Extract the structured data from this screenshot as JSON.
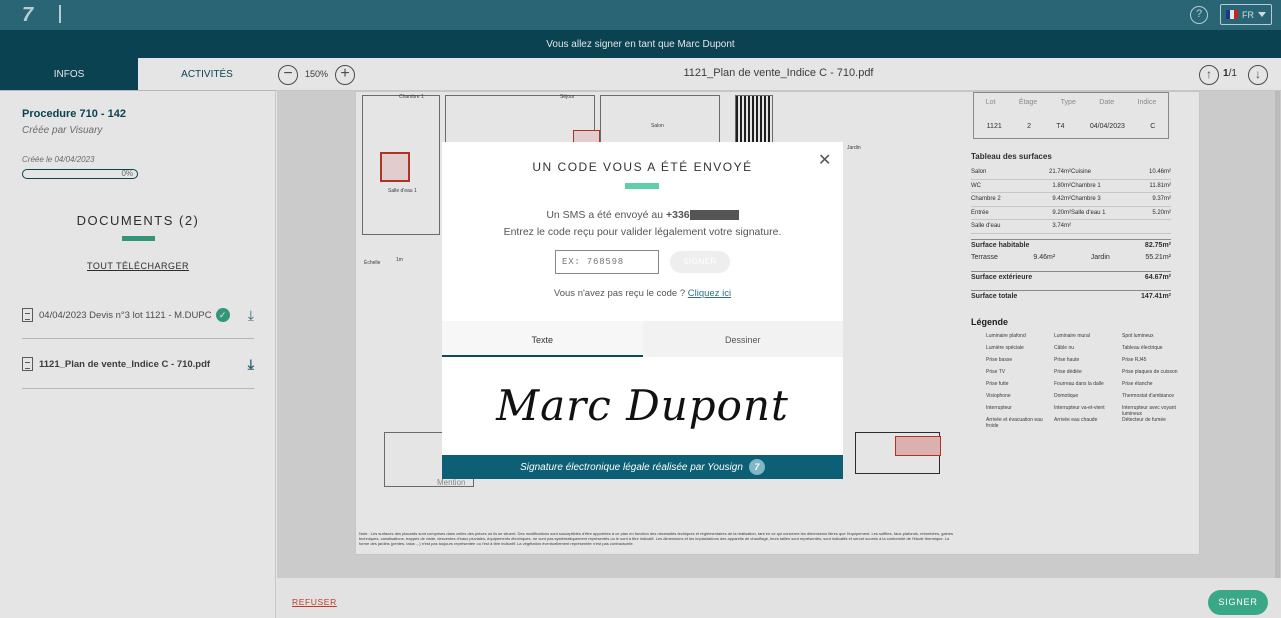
{
  "topbar": {
    "logo": "7",
    "help": "?",
    "lang": "FR",
    "flag_colors": [
      "#1f3f9a",
      "#ffffff",
      "#d42a2a"
    ]
  },
  "banner": {
    "text": "Vous allez signer en tant que Marc Dupont"
  },
  "tabs": [
    {
      "label": "INFOS"
    },
    {
      "label": "ACTIVITÉS"
    }
  ],
  "toolbar": {
    "zoom_out": "−",
    "zoom": "150%",
    "zoom_in": "+",
    "doc_name": "1121_Plan de vente_Indice C - 710.pdf",
    "page_current": "1",
    "page_sep": "/1"
  },
  "sidebar": {
    "procedure": "Procedure 710 - 142",
    "creator": "Créée par Visuary",
    "created": "Créée le 04/04/2023",
    "progress": "0%",
    "docs_title": "DOCUMENTS (2)",
    "download_all": "TOUT TÉLÉCHARGER",
    "documents": [
      {
        "name": "04/04/2023 Devis n°3 lot 1121 - M.DUPC",
        "signed": true
      },
      {
        "name": "1121_Plan de vente_Indice C - 710.pdf",
        "signed": false
      }
    ]
  },
  "plan": {
    "labels": [
      "Chambre 1",
      "Salle d'eau 1",
      "Séjour",
      "Jardin",
      "Échelle",
      "1m",
      "Mention",
      "Salon"
    ],
    "note": "Note : Les surfaces des placards sont comprises dans celles des pièces où ils se situent. Des modifications sont susceptibles d'être apportées à ce plan en fonction des nécessités techiques et réglementaires de la réalisation, tant en ce qui concerne les dimensions libres que l'équipement. Les soffites, faux-plafonds, retombées, gaines techniques, canalisations, trappes de visite, descentes d'eaux pluviales, équipements électriques, ne sont pas systématiquement représentés ou le sont à titre indicatif. Les dimensions et les implantations des appareils de chauffage, leurs tailles sont représentés, sont indicatifs et seront soumis à la conformité de l'étude thermique. La forme des jardins (pentes, talus ...) n'est pas toujours représentée ou l'est à titre indicatif. La végétation éventuellement représentée n'est pas contractuelle.",
    "lot_headers": [
      "Lot",
      "Étage",
      "Type",
      "Date",
      "Indice"
    ],
    "lot_values": [
      "1121",
      "2",
      "T4",
      "04/04/2023",
      "C"
    ],
    "surfaces_title": "Tableau des surfaces",
    "surfaces": [
      [
        "Salon",
        "21.74m²",
        "Cuisine",
        "10.46m²"
      ],
      [
        "WC",
        "1.80m²",
        "Chambre 1",
        "11.81m²"
      ],
      [
        "Chambre 2",
        "9.42m²",
        "Chambre 3",
        "9.37m²"
      ],
      [
        "Entrée",
        "9.20m²",
        "Salle d'eau 1",
        "5.20m²"
      ],
      [
        "Salle d'eau",
        "3.74m²",
        "",
        ""
      ]
    ],
    "surface_habitable": [
      "Surface habitable",
      "82.75m²"
    ],
    "exterior": [
      [
        "Terrasse",
        "9.46m²",
        "Jardin",
        "55.21m²"
      ]
    ],
    "surface_exterieure": [
      "Surface extérieure",
      "64.67m²"
    ],
    "surface_totale": [
      "Surface totale",
      "147.41m²"
    ],
    "legend_title": "Légende",
    "legend_items": [
      "Luminaire plafond",
      "Lumière spéciale",
      "Prise basse",
      "Prise TV",
      "Prise futte",
      "Visiophone",
      "Interrupteur",
      "Arrivée et évacuation eau froide",
      "Luminaire mural",
      "Câble nu",
      "Prise haute",
      "Prise dédiée",
      "Fourreau dans la dalle",
      "Domotique",
      "Interrupteur va-et-vient",
      "Arrivée eau chaude",
      "Spot lumineux",
      "Tableau électrique",
      "Prise RJ45",
      "Prise plaques de cuisson",
      "Prise étanche",
      "Thermostat d'ambiance",
      "Interrupteur avec voyant lumineux",
      "Détecteur de fumée"
    ]
  },
  "modal": {
    "title": "UN CODE VOUS A ÉTÉ ENVOYÉ",
    "sms_text": "Un SMS a été envoyé au",
    "phone": "+336",
    "enter_text": "Entrez le code reçu pour valider légalement votre signature.",
    "code_placeholder": "EX: 768598",
    "sign_button": "SIGNER",
    "resend_text": "Vous n'avez pas reçu le code ?",
    "resend_link": "Cliquez ici",
    "tabs": [
      "Texte",
      "Dessiner"
    ],
    "signature": "Marc Dupont",
    "footer": "Signature électronique légale réalisée par Yousign",
    "footer_logo": "7"
  },
  "footer": {
    "refuse": "REFUSER",
    "sign": "SIGNER"
  },
  "colors": {
    "primary": "#0c4a5c",
    "topbar": "#2f7183",
    "accent": "#3aa886"
  }
}
